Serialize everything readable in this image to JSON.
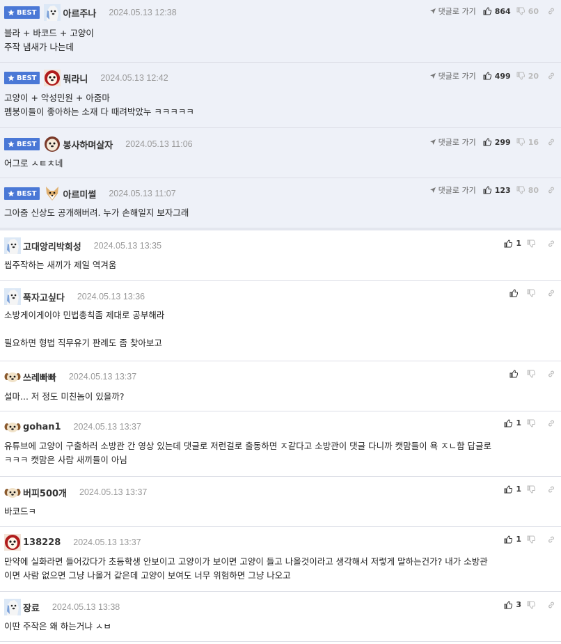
{
  "ui": {
    "reply_label": "댓글로 가기"
  },
  "best_comments": [
    {
      "nick": "아르주나",
      "date": "2024.05.13 12:38",
      "lines": [
        "블라 + 바코드 + 고양이",
        "주작 냄새가 나는데"
      ],
      "likes": "864",
      "dislikes": "60",
      "avatar": "white-dog"
    },
    {
      "nick": "뭐라니",
      "date": "2024.05.13 12:42",
      "lines": [
        "고양이 + 악성민원 + 아줌마",
        "펨붕이들이 좋아하는 소재 다 때려박았누 ㅋㅋㅋㅋㅋ"
      ],
      "likes": "499",
      "dislikes": "20",
      "avatar": "red-dog"
    },
    {
      "nick": "봉사하며살자",
      "date": "2024.05.13 11:06",
      "lines": [
        "어그로 ㅅㅌㅊ네"
      ],
      "likes": "299",
      "dislikes": "16",
      "avatar": "tan-dog"
    },
    {
      "nick": "아르미썰",
      "date": "2024.05.13 11:07",
      "lines": [
        "그아줌 신상도 공개해버려. 누가 손해일지 보자그래"
      ],
      "likes": "123",
      "dislikes": "80",
      "avatar": "shiba"
    }
  ],
  "comments": [
    {
      "nick": "고대앙리박희성",
      "date": "2024.05.13 13:35",
      "lines": [
        "씹주작하는 새끼가 제일 역겨움"
      ],
      "likes": "1",
      "avatar": "white-dog"
    },
    {
      "nick": "푹자고싶다",
      "date": "2024.05.13 13:36",
      "lines": [
        "소방게이게이야 민법총칙좀 제대로 공부해라",
        "",
        "필요하면 형법 직무유기 판례도 좀 찾아보고"
      ],
      "likes": "",
      "avatar": "white-dog"
    },
    {
      "nick": "쓰레빠빠",
      "date": "2024.05.13 13:37",
      "lines": [
        "설마... 저 정도 미친놈이 있을까?"
      ],
      "likes": "",
      "avatar": "tan-dog"
    },
    {
      "nick": "gohan1",
      "date": "2024.05.13 13:37",
      "lines": [
        "유튜브에 고양이 구출하러 소방관 간 영상 있는데 댓글로 저런걸로 출동하면 ㅈ같다고 소방관이 댓글 다니까 캣맘들이 욕 ㅈㄴ함 답글로",
        "ㅋㅋㅋ 캣맘은 사람 새끼들이 아님"
      ],
      "likes": "1",
      "avatar": "tan-dog"
    },
    {
      "nick": "버피500개",
      "date": "2024.05.13 13:37",
      "lines": [
        "바코드ㅋ"
      ],
      "likes": "1",
      "avatar": "tan-dog"
    },
    {
      "nick": "138228",
      "date": "2024.05.13 13:37",
      "lines": [
        "만약에 실화라면 들어갔다가 초등학생 안보이고 고양이가 보이면 고양이 들고 나올것이라고 생각해서 저렇게 말하는건가? 내가 소방관",
        "이면 사람 없으면 그냥 나올거 같은데 고양이 보여도 너무 위험하면 그냥 나오고"
      ],
      "likes": "1",
      "avatar": "red-dog"
    },
    {
      "nick": "장료",
      "date": "2024.05.13 13:38",
      "lines": [
        "이딴 주작은 왜 하는거냐 ㅅㅂ"
      ],
      "likes": "3",
      "avatar": "white-dog"
    }
  ]
}
